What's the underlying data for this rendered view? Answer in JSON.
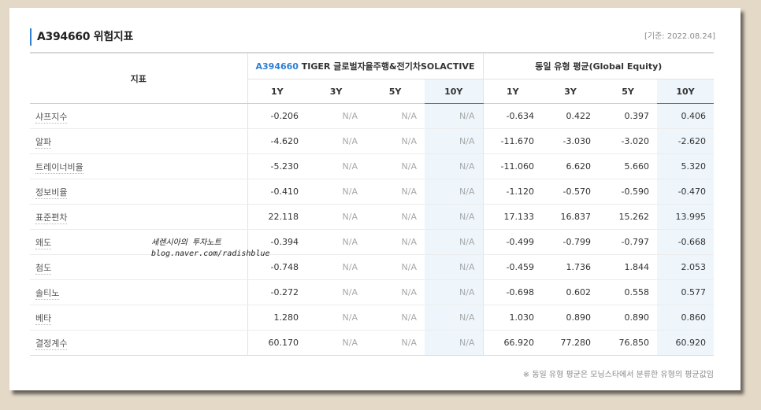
{
  "header": {
    "title": "A394660 위험지표",
    "basis": "[기준: 2022.08.24]"
  },
  "table": {
    "indicator_header": "지표",
    "fund_group": {
      "code": "A394660",
      "name": " TIGER 글로벌자율주행&전기차SOLACTIVE"
    },
    "peer_group": "동일 유형 평균(Global Equity)",
    "periods": [
      "1Y",
      "3Y",
      "5Y",
      "10Y",
      "1Y",
      "3Y",
      "5Y",
      "10Y"
    ],
    "rows": [
      {
        "name": "샤프지수",
        "values": [
          "-0.206",
          "N/A",
          "N/A",
          "N/A",
          "-0.634",
          "0.422",
          "0.397",
          "0.406"
        ]
      },
      {
        "name": "알파",
        "values": [
          "-4.620",
          "N/A",
          "N/A",
          "N/A",
          "-11.670",
          "-3.030",
          "-3.020",
          "-2.620"
        ]
      },
      {
        "name": "트레이너비율",
        "values": [
          "-5.230",
          "N/A",
          "N/A",
          "N/A",
          "-11.060",
          "6.620",
          "5.660",
          "5.320"
        ]
      },
      {
        "name": "정보비율",
        "values": [
          "-0.410",
          "N/A",
          "N/A",
          "N/A",
          "-1.120",
          "-0.570",
          "-0.590",
          "-0.470"
        ]
      },
      {
        "name": "표준편차",
        "values": [
          "22.118",
          "N/A",
          "N/A",
          "N/A",
          "17.133",
          "16.837",
          "15.262",
          "13.995"
        ]
      },
      {
        "name": "왜도",
        "values": [
          "-0.394",
          "N/A",
          "N/A",
          "N/A",
          "-0.499",
          "-0.799",
          "-0.797",
          "-0.668"
        ]
      },
      {
        "name": "첨도",
        "values": [
          "-0.748",
          "N/A",
          "N/A",
          "N/A",
          "-0.459",
          "1.736",
          "1.844",
          "2.053"
        ]
      },
      {
        "name": "솔티노",
        "values": [
          "-0.272",
          "N/A",
          "N/A",
          "N/A",
          "-0.698",
          "0.602",
          "0.558",
          "0.577"
        ]
      },
      {
        "name": "베타",
        "values": [
          "1.280",
          "N/A",
          "N/A",
          "N/A",
          "1.030",
          "0.890",
          "0.890",
          "0.860"
        ]
      },
      {
        "name": "결정계수",
        "values": [
          "60.170",
          "N/A",
          "N/A",
          "N/A",
          "66.920",
          "77.280",
          "76.850",
          "60.920"
        ]
      }
    ]
  },
  "watermark": {
    "line1": "세렌시아의 투자노트",
    "line2": "blog.naver.com/radishblue"
  },
  "note": "※ 동일 유형 평균은 모닝스타에서 분류한 유형의 평균값임",
  "colors": {
    "accent": "#2f7fd2",
    "highlight_column": "#eef6fc",
    "background": "#e4d9c7"
  }
}
